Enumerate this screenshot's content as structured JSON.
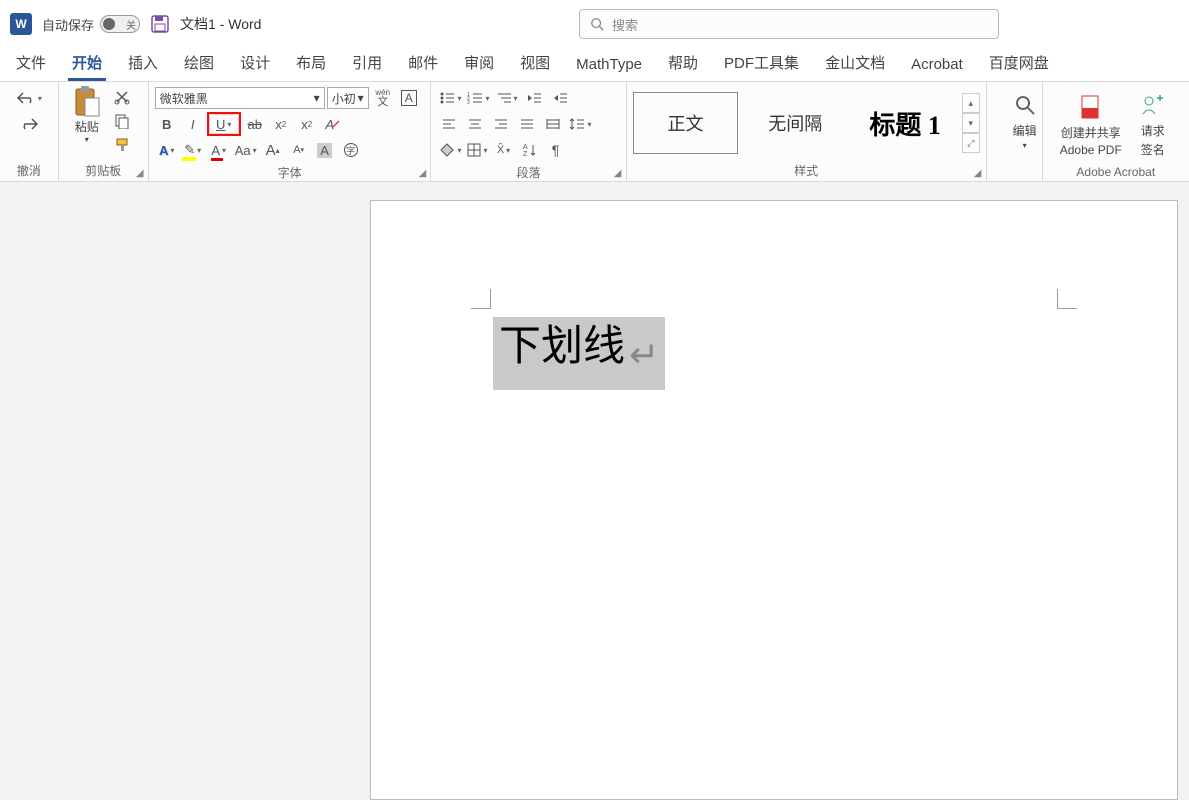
{
  "titlebar": {
    "app_letter": "W",
    "autosave_label": "自动保存",
    "toggle_off": "关",
    "doc_title": "文档1  -  Word",
    "search_placeholder": "搜索"
  },
  "tabs": {
    "file": "文件",
    "home": "开始",
    "insert": "插入",
    "draw": "绘图",
    "design": "设计",
    "layout": "布局",
    "references": "引用",
    "mailings": "邮件",
    "review": "审阅",
    "view": "视图",
    "mathtype": "MathType",
    "help": "帮助",
    "pdftools": "PDF工具集",
    "jinshan": "金山文档",
    "acrobat": "Acrobat",
    "baidu": "百度网盘"
  },
  "ribbon": {
    "undo_group": "撤消",
    "clipboard_group": "剪贴板",
    "paste_label": "粘贴",
    "font_group": "字体",
    "font_name": "微软雅黑",
    "font_size": "小初",
    "paragraph_group": "段落",
    "styles_group": "样式",
    "style_normal": "正文",
    "style_nospacing": "无间隔",
    "style_heading1": "标题 1",
    "edit_label": "编辑",
    "acrobat_create": "创建并共享",
    "acrobat_pdf": "Adobe PDF",
    "acrobat_sign": "请求",
    "acrobat_sign2": "签名",
    "acrobat_group": "Adobe Acrobat",
    "phonetic": "wén",
    "phonetic2": "文"
  },
  "document": {
    "selected_text": "下划线"
  }
}
